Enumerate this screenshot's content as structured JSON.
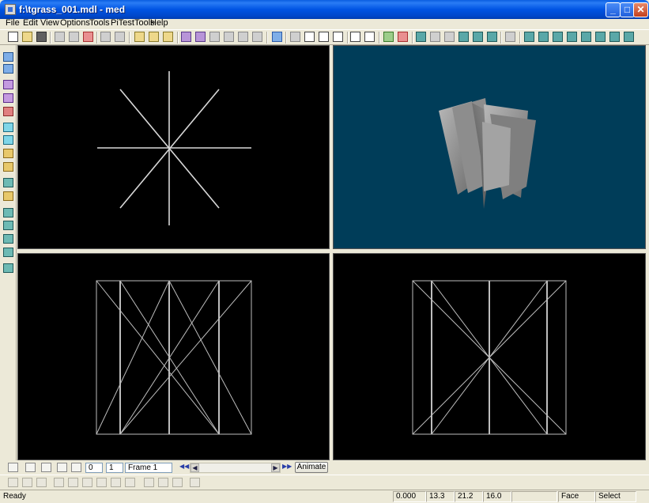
{
  "window": {
    "title": "f:\\tgrass_001.mdl - med",
    "minimize_glyph": "_",
    "maximize_glyph": "□",
    "close_glyph": "✕"
  },
  "menu": [
    {
      "label": "File"
    },
    {
      "label": "Edit"
    },
    {
      "label": "View"
    },
    {
      "label": "Options"
    },
    {
      "label": "Tools"
    },
    {
      "label": "PiTestTools"
    },
    {
      "label": "Help"
    }
  ],
  "toolbar": {
    "icons": [
      "new-file-icon",
      "open-folder-icon",
      "save-icon",
      "copy-icon",
      "paste-icon",
      "delete-icon",
      "undo-icon",
      "redo-icon",
      "view-single-icon",
      "view-dual-icon",
      "view-quad-icon",
      "mesh-icon",
      "box-icon",
      "frame-icon",
      "frame2-icon",
      "frame3-icon",
      "frame4-icon",
      "camera-icon",
      "select-icon",
      "rotate-icon",
      "scale-icon",
      "text-icon",
      "move-tool-icon",
      "pan-icon",
      "light-green-icon",
      "red-triangle-icon",
      "vertex-icon",
      "edge-icon",
      "dots-icon",
      "face-icon",
      "wire-icon",
      "tri-icon",
      "lock-icon",
      "render1-icon",
      "render2-icon",
      "render3-icon",
      "render4-icon",
      "render5-icon",
      "render6-icon",
      "render7-icon"
    ]
  },
  "left_toolbar": {
    "icons": [
      "left-tool-1",
      "left-tool-2",
      "left-tool-3",
      "left-tool-4",
      "left-tool-5",
      "left-tool-6",
      "left-tool-7",
      "left-tool-8",
      "left-tool-9",
      "left-tool-10",
      "left-tool-11",
      "left-tool-12",
      "left-tool-13",
      "left-tool-14",
      "left-tool-15",
      "left-tool-16",
      "left-tool-17"
    ]
  },
  "viewports": {
    "top_left": {
      "view": "top"
    },
    "top_right": {
      "view": "perspective",
      "background": "#003d59"
    },
    "bottom_left": {
      "view": "front"
    },
    "bottom_right": {
      "view": "side"
    }
  },
  "animation": {
    "start_frame": "0",
    "current_frame": "1",
    "frame_name": "Frame 1",
    "rewind_glyph": "◀◀",
    "forward_glyph": "▶▶",
    "scroll_left_glyph": "◀",
    "scroll_right_glyph": "▶",
    "animate_label": "Animate"
  },
  "status": {
    "text": "Ready",
    "coord_1": "0.000",
    "coord_2": "13.3",
    "coord_3": "21.2",
    "coord_4": "16.0",
    "mode": "Face",
    "tool": "Select"
  }
}
